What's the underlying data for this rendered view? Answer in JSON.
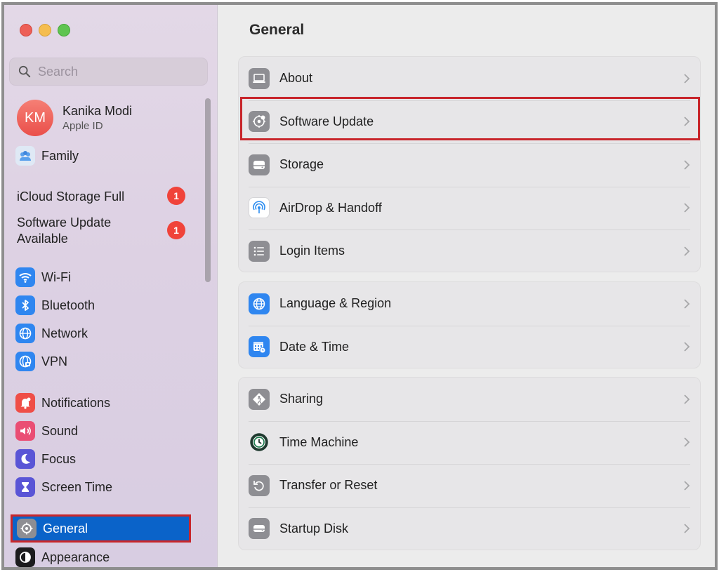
{
  "sidebar": {
    "search_placeholder": "Search",
    "profile": {
      "initials": "KM",
      "name": "Kanika Modi",
      "subtitle": "Apple ID"
    },
    "family_label": "Family",
    "notices": [
      {
        "label": "iCloud Storage Full",
        "count": "1"
      },
      {
        "label_line1": "Software Update",
        "label_line2": "Available",
        "count": "1"
      }
    ],
    "items": [
      {
        "label": "Wi-Fi",
        "icon": "wifi-icon"
      },
      {
        "label": "Bluetooth",
        "icon": "bluetooth-icon"
      },
      {
        "label": "Network",
        "icon": "network-icon"
      },
      {
        "label": "VPN",
        "icon": "vpn-icon"
      },
      {
        "label": "Notifications",
        "icon": "notifications-icon"
      },
      {
        "label": "Sound",
        "icon": "sound-icon"
      },
      {
        "label": "Focus",
        "icon": "focus-icon"
      },
      {
        "label": "Screen Time",
        "icon": "screen-time-icon"
      },
      {
        "label": "General",
        "icon": "gear-icon",
        "selected": true
      },
      {
        "label": "Appearance",
        "icon": "appearance-icon"
      }
    ]
  },
  "main": {
    "title": "General",
    "groups": [
      [
        {
          "label": "About",
          "icon": "laptop-icon"
        },
        {
          "label": "Software Update",
          "icon": "software-update-gear-icon",
          "highlighted": true
        },
        {
          "label": "Storage",
          "icon": "storage-drive-icon"
        },
        {
          "label": "AirDrop & Handoff",
          "icon": "airdrop-icon"
        },
        {
          "label": "Login Items",
          "icon": "list-icon"
        }
      ],
      [
        {
          "label": "Language & Region",
          "icon": "globe-icon"
        },
        {
          "label": "Date & Time",
          "icon": "calendar-clock-icon"
        }
      ],
      [
        {
          "label": "Sharing",
          "icon": "sharing-icon"
        },
        {
          "label": "Time Machine",
          "icon": "time-machine-icon"
        },
        {
          "label": "Transfer or Reset",
          "icon": "reset-icon"
        },
        {
          "label": "Startup Disk",
          "icon": "startup-disk-icon"
        }
      ]
    ]
  },
  "colors": {
    "accent": "#0a63c9",
    "highlight_border": "#c8262b",
    "badge": "#f0433a"
  }
}
